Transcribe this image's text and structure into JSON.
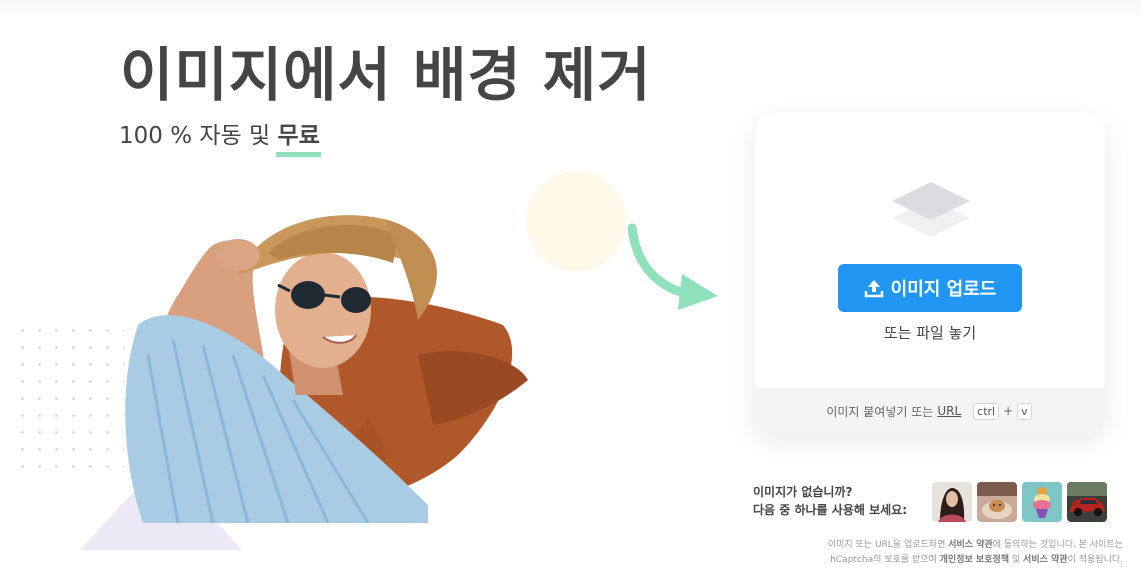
{
  "hero": {
    "title": "이미지에서 배경 제거",
    "subtitle_prefix": "100 % 자동 및 ",
    "subtitle_free": "무료"
  },
  "upload": {
    "button_label": "이미지 업로드",
    "drop_text": "또는 파일 놓기",
    "paste_text": "이미지 붙여넣기 또는",
    "url_label": "URL",
    "kbd_ctrl": "ctrl",
    "kbd_plus": "+",
    "kbd_v": "v"
  },
  "samples": {
    "line1": "이미지가 없습니까?",
    "line2": "다음 중 하나를 사용해 보세요:",
    "thumbnails": [
      "woman-portrait",
      "dog-in-bed",
      "ice-cream-cone",
      "red-car"
    ]
  },
  "legal": {
    "line1_a": "이미지 또는 URL을 업로드하면 ",
    "line1_terms": "서비스 약관",
    "line1_b": "에 동의하는 것입니다. 본 사이트는",
    "line2_a": "hCaptcha의 보호를 받으며 ",
    "line2_privacy": "개인정보 보호정책",
    "line2_mid": " 및 ",
    "line2_terms": "서비스 약관",
    "line2_b": "이 적용됩니다."
  },
  "colors": {
    "primary": "#2196f3",
    "accent_green": "#8fe0bb",
    "text": "#454545"
  }
}
